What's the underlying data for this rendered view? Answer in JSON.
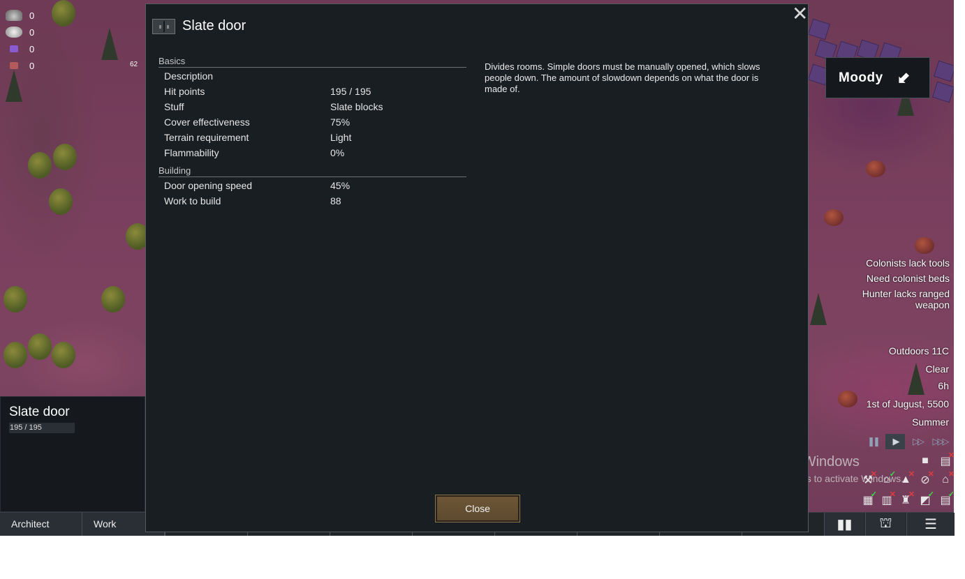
{
  "resources": [
    {
      "icon": "steel-icon",
      "count": "0"
    },
    {
      "icon": "silver-icon",
      "count": "0"
    },
    {
      "icon": "purple-resource-icon",
      "count": "0"
    },
    {
      "icon": "red-resource-icon",
      "count": "0"
    }
  ],
  "map_label": "62",
  "inspect": {
    "title": "Slate door",
    "hp": "195 / 195"
  },
  "dialog": {
    "title": "Slate door",
    "sections": [
      {
        "name": "Basics",
        "rows": [
          {
            "label": "Description",
            "value": ""
          },
          {
            "label": "Hit points",
            "value": "195 / 195"
          },
          {
            "label": "Stuff",
            "value": "Slate blocks"
          },
          {
            "label": "Cover effectiveness",
            "value": "75%"
          },
          {
            "label": "Terrain requirement",
            "value": "Light"
          },
          {
            "label": "Flammability",
            "value": "0%"
          }
        ]
      },
      {
        "name": "Building",
        "rows": [
          {
            "label": "Door opening speed",
            "value": "45%"
          },
          {
            "label": "Work to build",
            "value": "88"
          }
        ]
      }
    ],
    "description": "Divides rooms. Simple doors must be manually opened, which slows people down. The amount of slowdown depends on what the door is made of.",
    "close_label": "Close"
  },
  "mood": {
    "label": "Moody",
    "arrow": "⬋"
  },
  "alerts": [
    "Colonists lack tools",
    "Need colonist beds",
    "Hunter lacks ranged weapon"
  ],
  "status": {
    "temperature": "Outdoors 11C",
    "weather": "Clear",
    "hour": "6h",
    "date": "1st of Jugust, 5500",
    "season": "Summer"
  },
  "speed": {
    "pause": "❚❚",
    "normal": "▶",
    "fast": "▷▷",
    "superfast": "▷▷▷"
  },
  "bottom_tabs": [
    "Architect",
    "Work"
  ],
  "activate": {
    "line1": "Activate Windows",
    "line2": "Go to Settings to activate Windows."
  }
}
